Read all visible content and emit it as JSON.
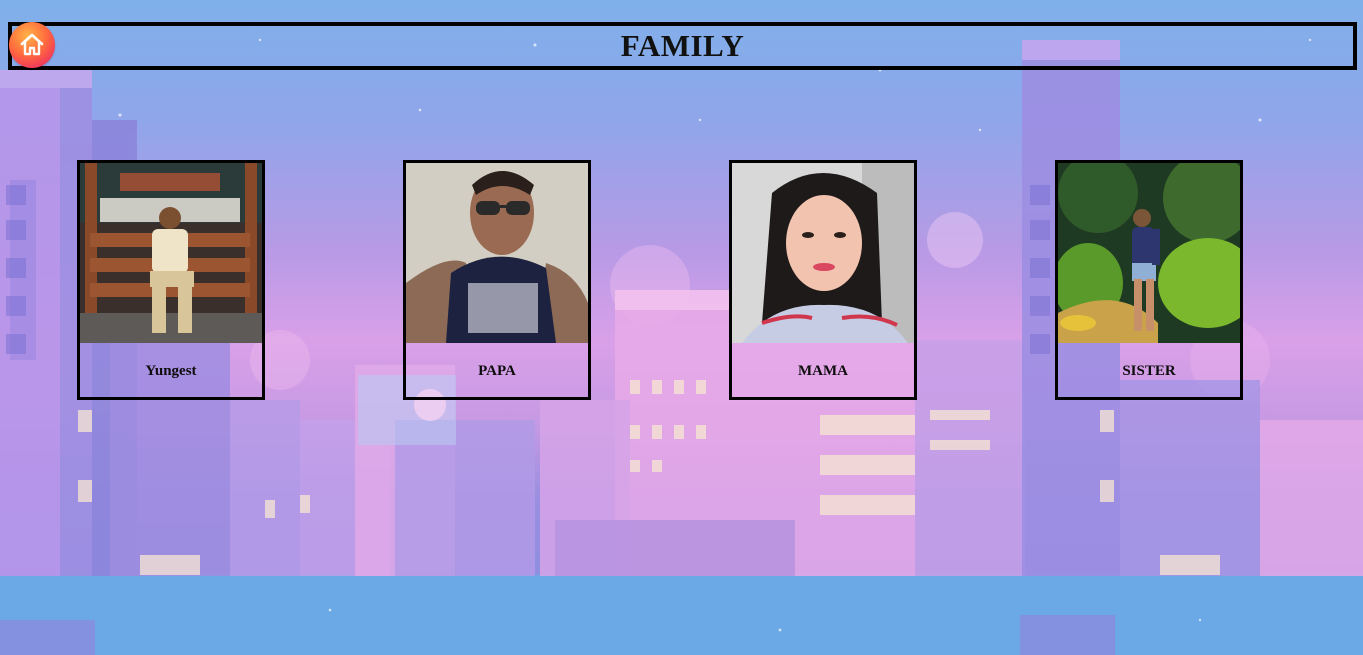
{
  "page": {
    "title": "FAMILY"
  },
  "nav": {
    "home_icon": "home-icon"
  },
  "members": [
    {
      "label": "Yungest",
      "photo": "young-man-sitting-on-bench-photo"
    },
    {
      "label": "PAPA",
      "photo": "man-in-sunglasses-selfie-photo"
    },
    {
      "label": "MAMA",
      "photo": "woman-portrait-photo"
    },
    {
      "label": "SISTER",
      "photo": "woman-in-garden-photo"
    }
  ],
  "colors": {
    "sky_top": "#7fb0ea",
    "sky_pink": "#d9a0e8",
    "building_pink": "#e9a7e4",
    "building_purple": "#8a86de",
    "border": "#000000",
    "home_button": "#ff6b3d"
  }
}
